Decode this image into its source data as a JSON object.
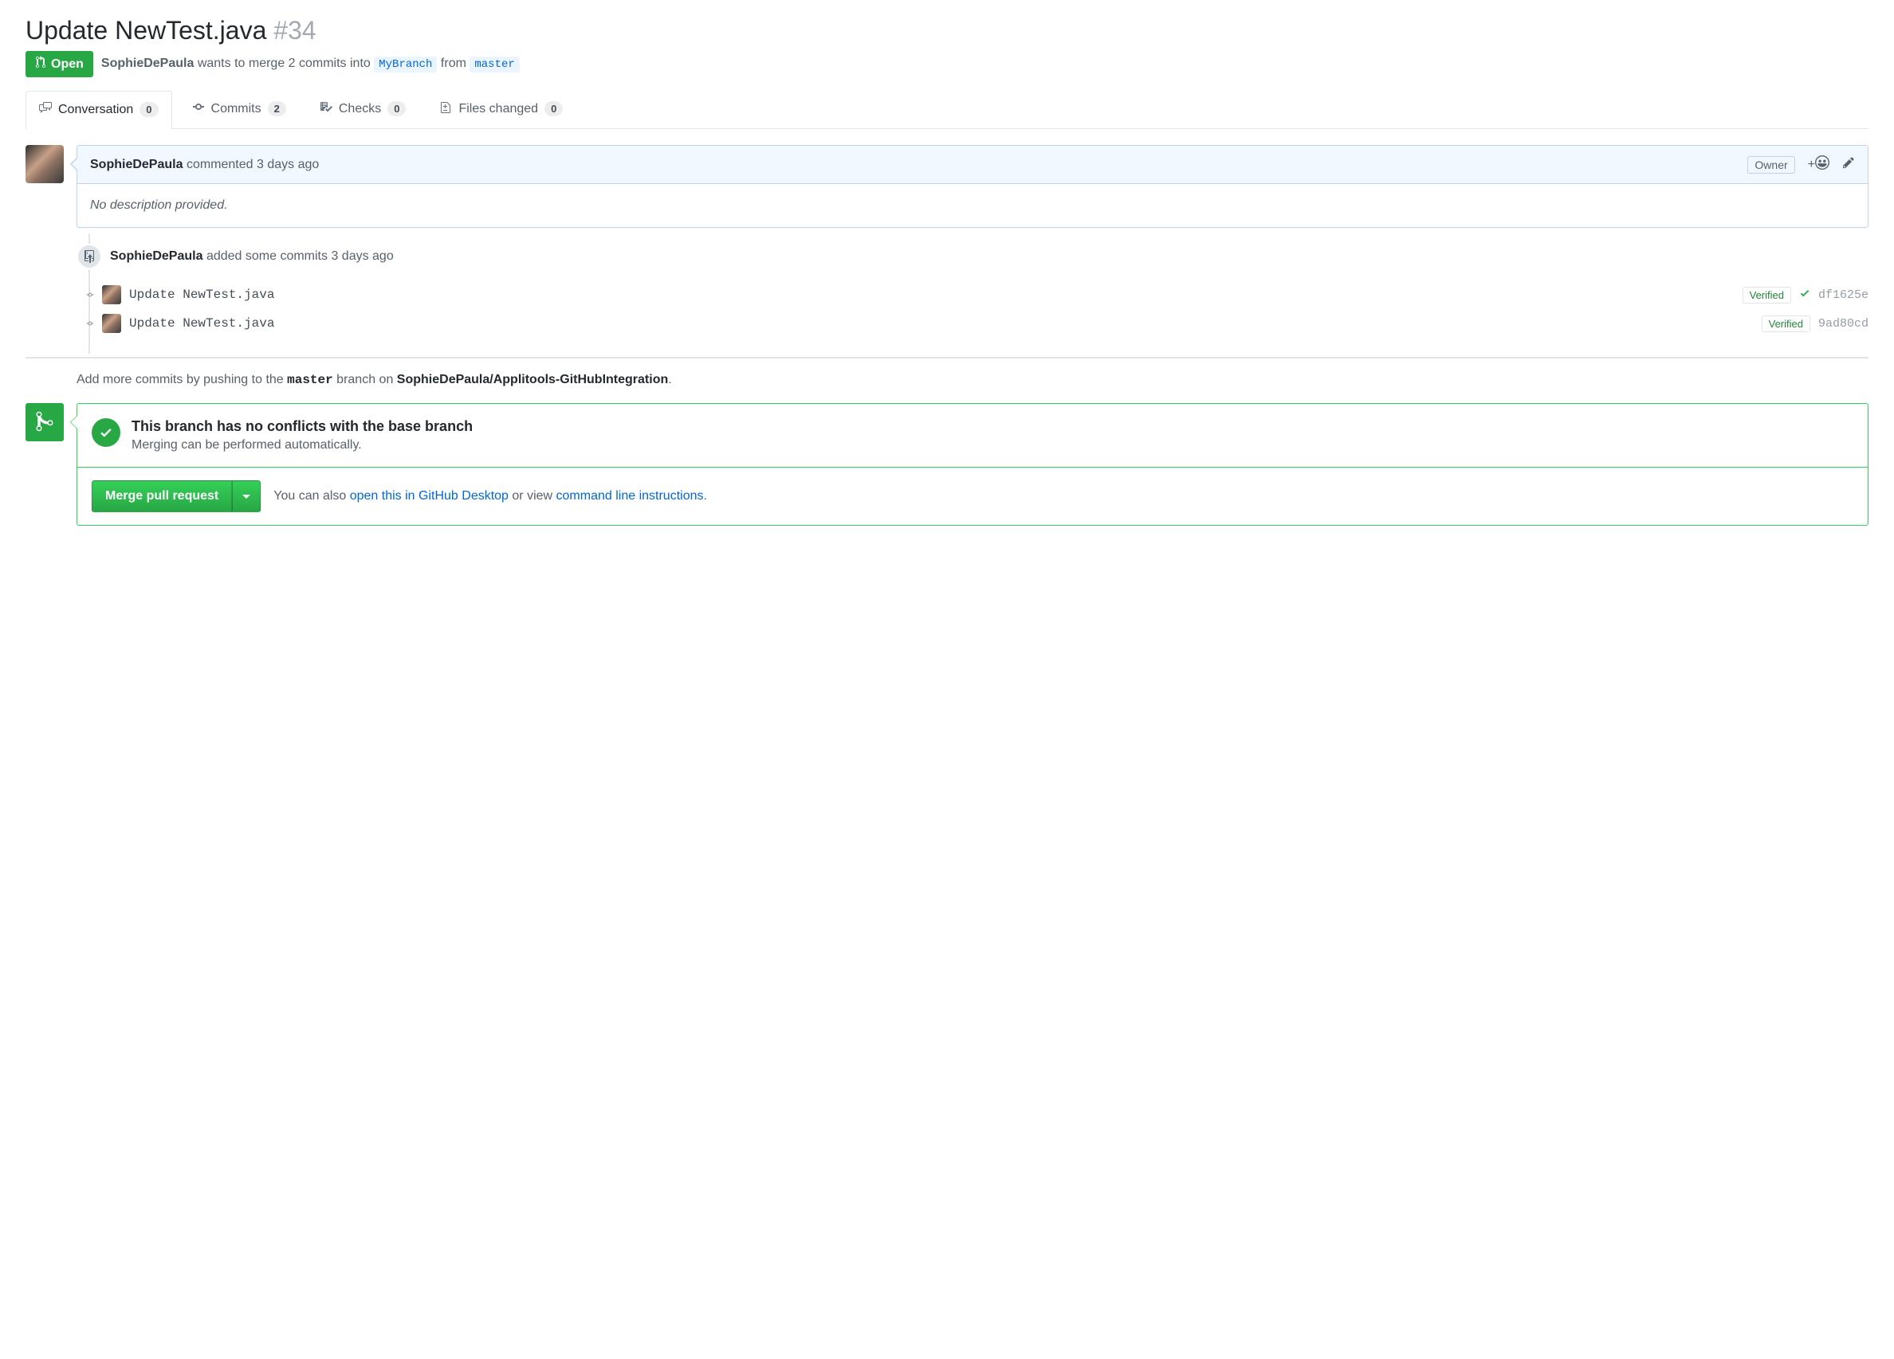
{
  "pr": {
    "title": "Update NewTest.java",
    "number": "#34",
    "state_label": "Open",
    "author": "SophieDePaula",
    "merge_text_1": "wants to merge 2 commits into",
    "base_branch": "MyBranch",
    "from_word": "from",
    "head_branch": "master"
  },
  "tabs": {
    "conversation": {
      "label": "Conversation",
      "count": "0"
    },
    "commits": {
      "label": "Commits",
      "count": "2"
    },
    "checks": {
      "label": "Checks",
      "count": "0"
    },
    "files": {
      "label": "Files changed",
      "count": "0"
    }
  },
  "comment": {
    "author": "SophieDePaula",
    "rest": "commented 3 days ago",
    "owner_badge": "Owner",
    "reaction_prefix": "+",
    "body": "No description provided."
  },
  "events": {
    "header_author": "SophieDePaula",
    "header_rest": "added some commits 3 days ago",
    "commits": [
      {
        "msg": "Update NewTest.java",
        "verified": "Verified",
        "sha": "df1625e",
        "has_check": true
      },
      {
        "msg": "Update NewTest.java",
        "verified": "Verified",
        "sha": "9ad80cd",
        "has_check": false
      }
    ]
  },
  "push_hint": {
    "prefix": "Add more commits by pushing to the ",
    "branch": "master",
    "mid": " branch on ",
    "repo": "SophieDePaula/Applitools-GitHubIntegration",
    "suffix": "."
  },
  "merge": {
    "title": "This branch has no conflicts with the base branch",
    "sub": "Merging can be performed automatically.",
    "button": "Merge pull request",
    "also_prefix": "You can also ",
    "link_desktop": "open this in GitHub Desktop",
    "also_mid": " or view ",
    "link_cli": "command line instructions",
    "suffix": "."
  }
}
